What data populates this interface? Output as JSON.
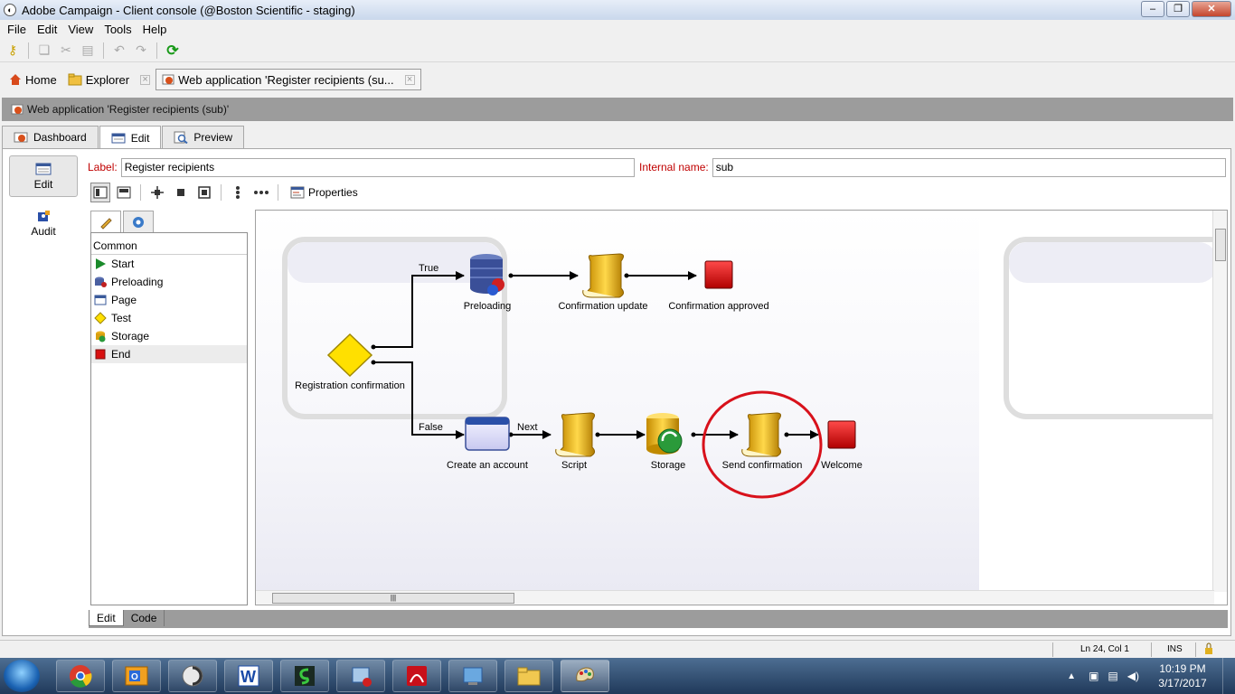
{
  "window": {
    "title": "Adobe Campaign - Client console (@Boston Scientific - staging)"
  },
  "menu": [
    "File",
    "Edit",
    "View",
    "Tools",
    "Help"
  ],
  "doc_tabs": [
    {
      "label": "Home"
    },
    {
      "label": "Explorer"
    },
    {
      "label": "Web application 'Register recipients (su..."
    }
  ],
  "header": {
    "title": "Web application 'Register recipients (sub)'"
  },
  "sub_tabs": [
    {
      "label": "Dashboard"
    },
    {
      "label": "Edit"
    },
    {
      "label": "Preview"
    }
  ],
  "left_nav": [
    {
      "label": "Edit"
    },
    {
      "label": "Audit"
    }
  ],
  "form": {
    "label_caption": "Label:",
    "label_value": "Register recipients",
    "internal_name_caption": "Internal name:",
    "internal_name_value": "sub"
  },
  "editor_toolbar": {
    "properties_label": "Properties"
  },
  "palette": {
    "category": "Common",
    "items": [
      {
        "label": "Start",
        "icon": "start-arrow-icon"
      },
      {
        "label": "Preloading",
        "icon": "preloading-icon"
      },
      {
        "label": "Page",
        "icon": "page-icon"
      },
      {
        "label": "Test",
        "icon": "test-diamond-icon"
      },
      {
        "label": "Storage",
        "icon": "storage-icon"
      },
      {
        "label": "End",
        "icon": "end-square-icon"
      }
    ]
  },
  "workflow": {
    "nodes": {
      "registration_confirmation": "Registration confirmation",
      "preloading": "Preloading",
      "confirmation_update": "Confirmation update",
      "confirmation_approved": "Confirmation approved",
      "create_account": "Create an account",
      "script": "Script",
      "storage": "Storage",
      "send_confirmation": "Send confirmation",
      "welcome": "Welcome"
    },
    "edges": {
      "true_label": "True",
      "false_label": "False",
      "next_label": "Next"
    },
    "highlight_color": "#d8111b"
  },
  "bottom_tabs": [
    {
      "label": "Edit"
    },
    {
      "label": "Code"
    }
  ],
  "status": {
    "position": "Ln 24, Col 1",
    "mode": "INS"
  },
  "taskbar": {
    "time": "10:19 PM",
    "date": "3/17/2017",
    "apps": [
      "chrome-icon",
      "outlook-icon",
      "app-icon",
      "word-icon",
      "app2-icon",
      "app3-icon",
      "acrobat-icon",
      "app4-icon",
      "explorer-icon",
      "campaign-icon"
    ]
  }
}
